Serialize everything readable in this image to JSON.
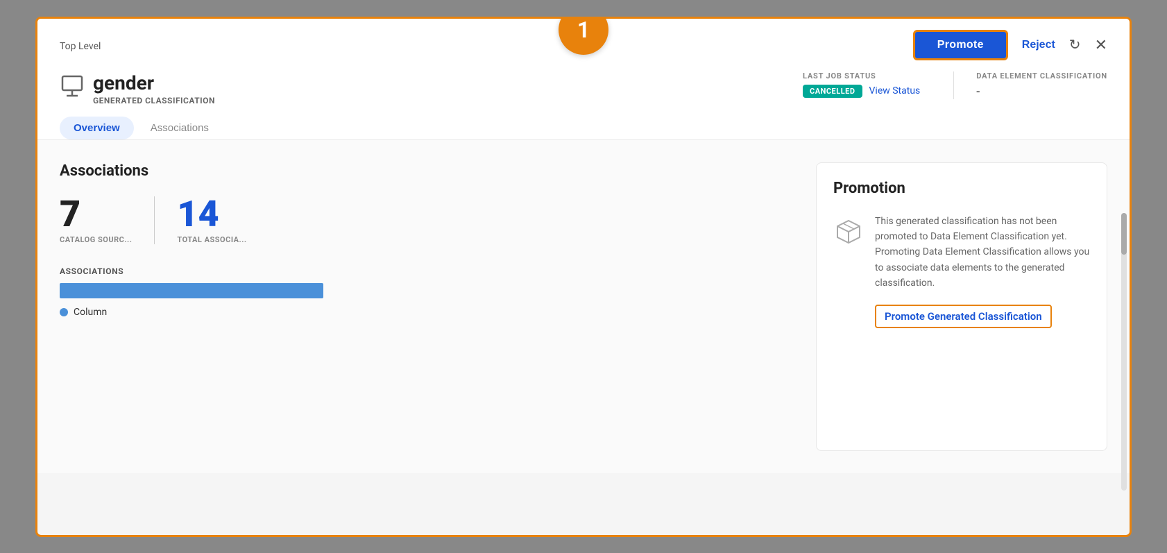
{
  "header": {
    "top_level_label": "Top Level",
    "badge_number": "1",
    "promote_btn_label": "Promote",
    "reject_btn_label": "Reject",
    "refresh_icon_char": "↻",
    "close_icon_char": "✕"
  },
  "entity": {
    "name": "gender",
    "subtitle": "GENERATED CLASSIFICATION",
    "icon_char": "⊞"
  },
  "status": {
    "last_job_label": "LAST JOB STATUS",
    "cancelled_label": "CANCELLED",
    "view_status_label": "View Status",
    "data_element_label": "DATA ELEMENT CLASSIFICATION",
    "data_element_value": "-"
  },
  "tabs": [
    {
      "label": "Overview",
      "active": true
    },
    {
      "label": "Associations",
      "active": false
    }
  ],
  "associations_section": {
    "title": "Associations",
    "stat1_value": "7",
    "stat1_label": "CATALOG SOURC...",
    "stat2_value": "14",
    "stat2_label": "TOTAL ASSOCIA...",
    "bar_section_label": "ASSOCIATIONS",
    "legend_label": "Column"
  },
  "promotion_section": {
    "title": "Promotion",
    "description": "This generated classification has not been promoted to Data Element Classification yet. Promoting Data Element Classification allows you to associate data elements to the generated classification.",
    "promote_link_label": "Promote Generated Classification"
  }
}
